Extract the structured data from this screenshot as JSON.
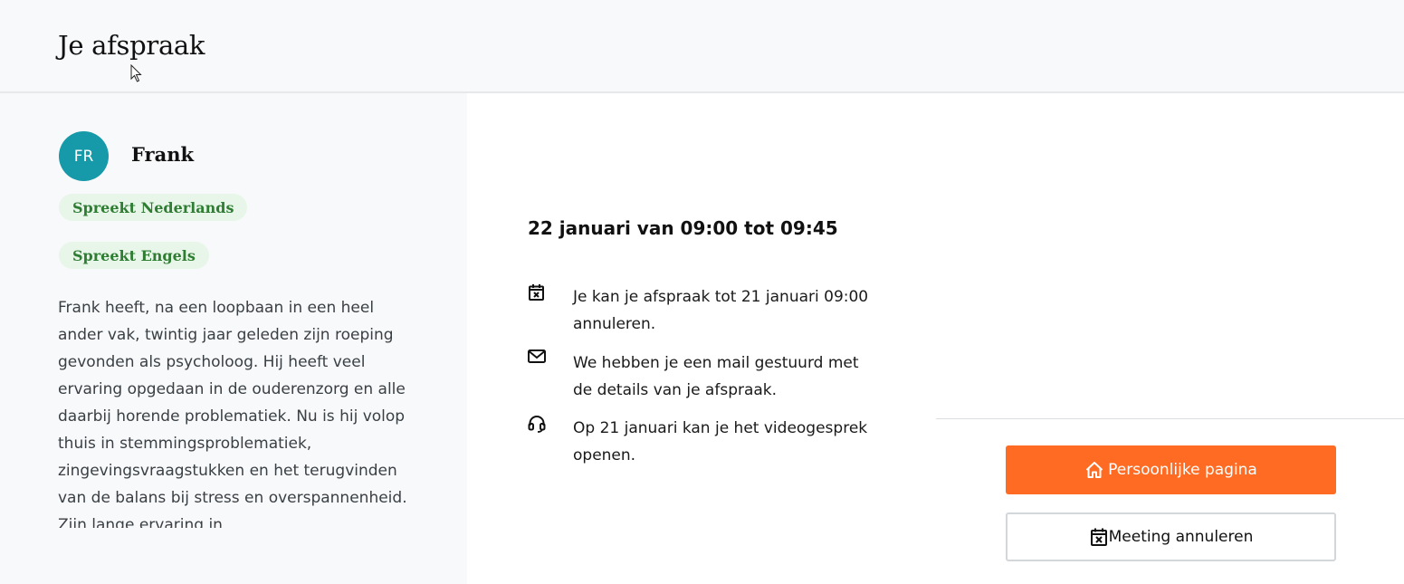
{
  "header": {
    "title": "Je afspraak"
  },
  "counselor": {
    "initials": "FR",
    "name": "Frank",
    "languages": [
      "Spreekt Nederlands",
      "Spreekt Engels"
    ],
    "bio": "Frank heeft, na een loopbaan in een heel ander vak, twintig jaar geleden zijn roeping gevonden als psycholoog. Hij heeft veel ervaring opgedaan in de ouderenzorg en alle daarbij horende problematiek. Nu is hij volop thuis in stemmingsproblematiek, zingevingsvraagstukken en het terugvinden van de balans bij stress en overspannenheid. Zijn lange ervaring in",
    "avatar_color": "#1699a8"
  },
  "appointment": {
    "time": "22 januari van 09:00 tot 09:45",
    "info": [
      {
        "icon": "calendar-x-icon",
        "text": "Je kan je afspraak tot 21 januari 09:00 annuleren."
      },
      {
        "icon": "mail-icon",
        "text": "We hebben je een mail gestuurd met de details van je afspraak."
      },
      {
        "icon": "headset-icon",
        "text": "Op 21 januari kan je het videogesprek openen."
      }
    ]
  },
  "actions": {
    "primary_label": "Persoonlijke pagina",
    "primary_icon": "home-icon",
    "secondary_label": "Meeting annuleren",
    "secondary_icon": "calendar-x-icon",
    "accent_color": "#ff6b22"
  }
}
